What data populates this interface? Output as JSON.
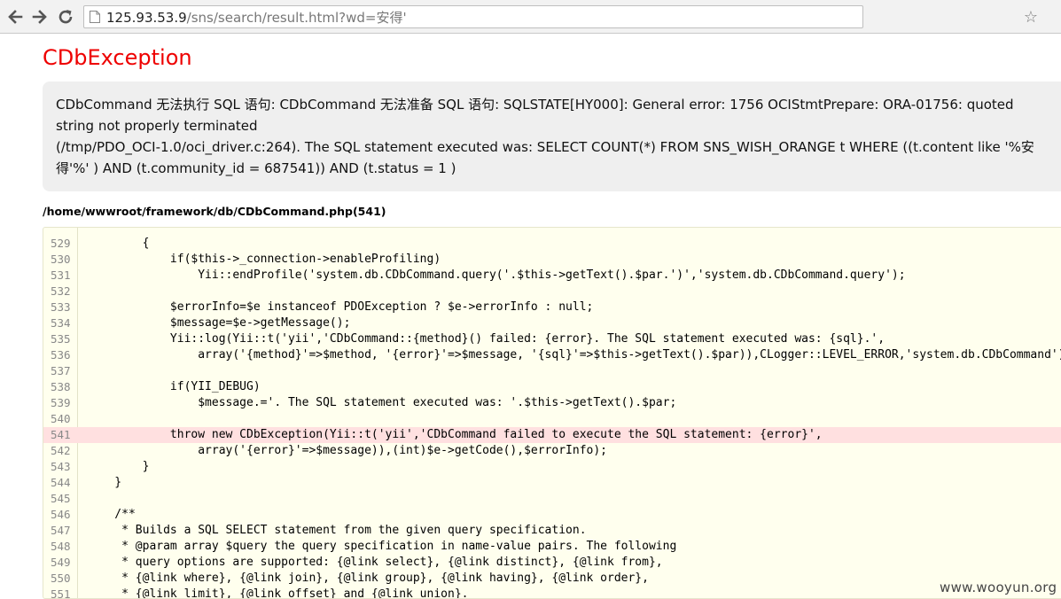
{
  "browser": {
    "url_host": "125.93.53.9",
    "url_rest": "/sns/search/result.html?wd=安得'"
  },
  "exception": {
    "title": "CDbException",
    "message": "CDbCommand 无法执行 SQL 语句: CDbCommand 无法准备 SQL 语句: SQLSTATE[HY000]: General error: 1756 OCIStmtPrepare: ORA-01756: quoted string not properly terminated\n(/tmp/PDO_OCI-1.0/oci_driver.c:264). The SQL statement executed was: SELECT COUNT(*) FROM SNS_WISH_ORANGE t WHERE ((t.content like '%安得'%' ) AND (t.community_id = 687541)) AND (t.status = 1 )"
  },
  "source": {
    "file": "/home/wwwroot/framework/db/CDbCommand.php(541)",
    "error_line": "541",
    "lines": [
      {
        "num": "529",
        "code": "        {"
      },
      {
        "num": "530",
        "code": "            if($this->_connection->enableProfiling)"
      },
      {
        "num": "531",
        "code": "                Yii::endProfile('system.db.CDbCommand.query('.$this->getText().$par.')','system.db.CDbCommand.query');"
      },
      {
        "num": "532",
        "code": ""
      },
      {
        "num": "533",
        "code": "            $errorInfo=$e instanceof PDOException ? $e->errorInfo : null;"
      },
      {
        "num": "534",
        "code": "            $message=$e->getMessage();"
      },
      {
        "num": "535",
        "code": "            Yii::log(Yii::t('yii','CDbCommand::{method}() failed: {error}. The SQL statement executed was: {sql}.',"
      },
      {
        "num": "536",
        "code": "                array('{method}'=>$method, '{error}'=>$message, '{sql}'=>$this->getText().$par)),CLogger::LEVEL_ERROR,'system.db.CDbCommand');"
      },
      {
        "num": "537",
        "code": ""
      },
      {
        "num": "538",
        "code": "            if(YII_DEBUG)"
      },
      {
        "num": "539",
        "code": "                $message.='. The SQL statement executed was: '.$this->getText().$par;"
      },
      {
        "num": "540",
        "code": ""
      },
      {
        "num": "541",
        "code": "            throw new CDbException(Yii::t('yii','CDbCommand failed to execute the SQL statement: {error}',"
      },
      {
        "num": "542",
        "code": "                array('{error}'=>$message)),(int)$e->getCode(),$errorInfo);"
      },
      {
        "num": "543",
        "code": "        }"
      },
      {
        "num": "544",
        "code": "    }"
      },
      {
        "num": "545",
        "code": ""
      },
      {
        "num": "546",
        "code": "    /**"
      },
      {
        "num": "547",
        "code": "     * Builds a SQL SELECT statement from the given query specification."
      },
      {
        "num": "548",
        "code": "     * @param array $query the query specification in name-value pairs. The following"
      },
      {
        "num": "549",
        "code": "     * query options are supported: {@link select}, {@link distinct}, {@link from},"
      },
      {
        "num": "550",
        "code": "     * {@link where}, {@link join}, {@link group}, {@link having}, {@link order},"
      },
      {
        "num": "551",
        "code": "     * {@link limit}, {@link offset} and {@link union}."
      }
    ]
  },
  "watermark": "www.wooyun.org"
}
